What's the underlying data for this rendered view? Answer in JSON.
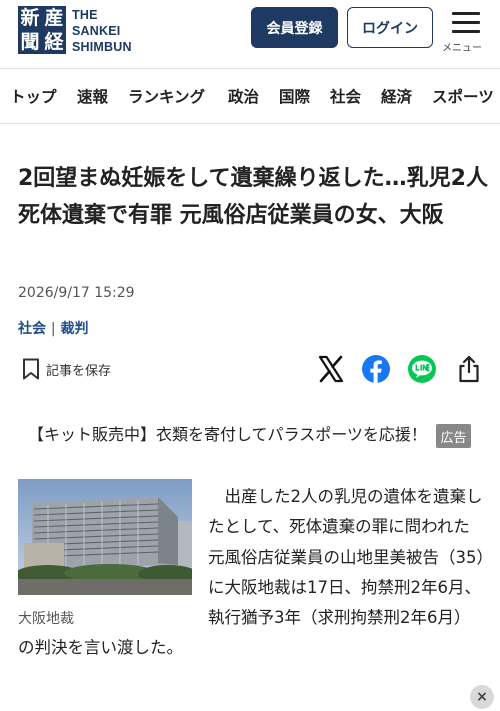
{
  "header": {
    "logo_chars": [
      "新",
      "産",
      "聞",
      "経"
    ],
    "logo_line1": "THE",
    "logo_line2": "SANKEI",
    "logo_line3": "SHIMBUN",
    "member_button": "会員登録",
    "login_button": "ログイン",
    "menu_label": "メニュー"
  },
  "nav": {
    "items": [
      "トップ",
      "速報",
      "ランキング",
      "政治",
      "国際",
      "社会",
      "経済",
      "スポーツ"
    ]
  },
  "article": {
    "title": "2回望まぬ妊娠をして遺棄繰り返した…乳児2人死体遺棄で有罪 元風俗店従業員の女、大阪",
    "date": "2026/9/17 15:29",
    "category_main": "社会",
    "category_sep": "|",
    "category_sub": "裁判",
    "save_label": "記事を保存",
    "photo_caption": "大阪地裁",
    "body": "　出産した2人の乳児の遺体を遺棄したとして、死体遺棄の罪に問われた元風俗店従業員の山地里美被告（35）に大阪地裁は17日、拘禁刑2年6月、執行猶予3年（求刑拘禁刑2年6月）の判決を言い渡した。"
  },
  "ad": {
    "text": "【キット販売中】衣類を寄付してパラスポーツを応援！",
    "badge": "広告",
    "close": "×"
  },
  "share_icons": [
    "x-icon",
    "facebook-icon",
    "line-icon",
    "share-icon"
  ],
  "colors": {
    "brand_navy": "#1e3a63",
    "category_link": "#1e4f8c",
    "facebook": "#1877f2",
    "line": "#06c755",
    "ad_badge": "#888888"
  }
}
